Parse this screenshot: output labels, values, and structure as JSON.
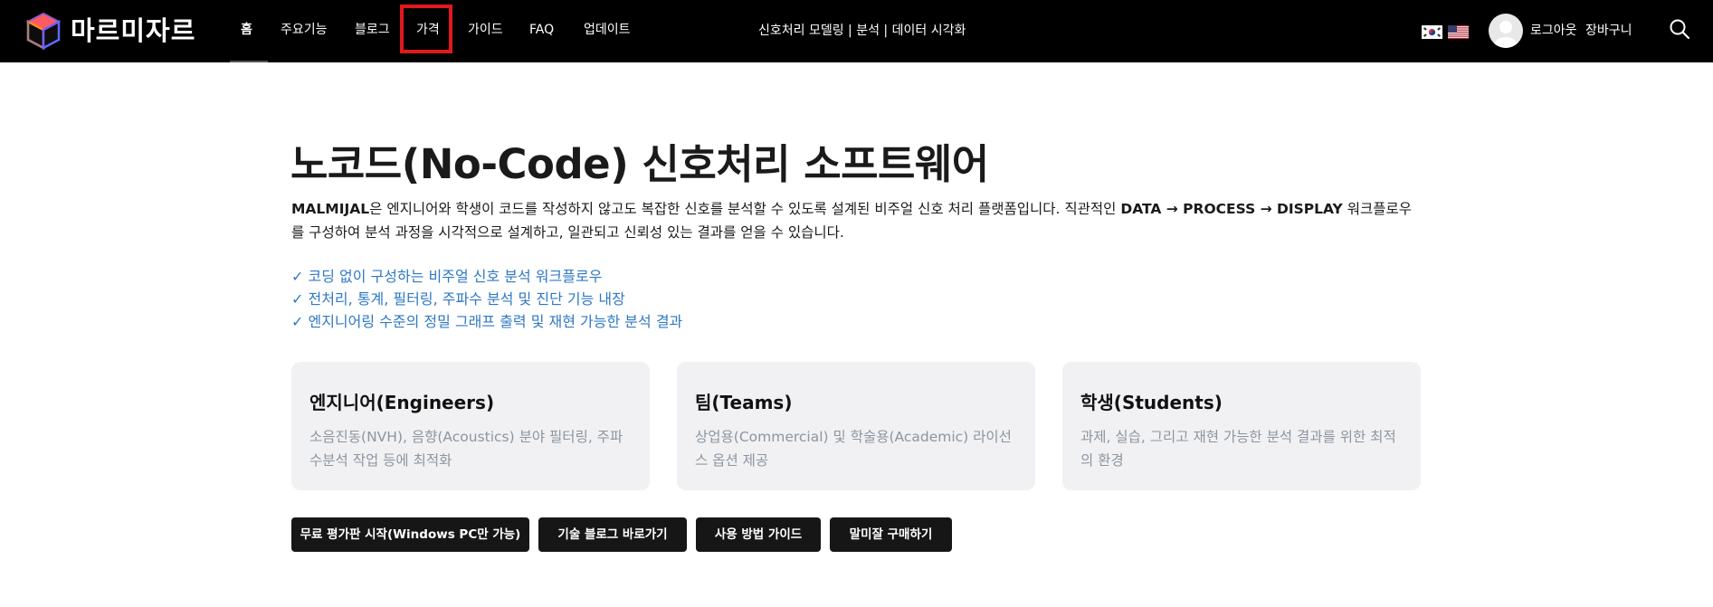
{
  "header": {
    "brand_name": "마르미자르",
    "nav": [
      {
        "label": "홈"
      },
      {
        "label": "주요기능"
      },
      {
        "label": "블로그"
      },
      {
        "label": "가격"
      },
      {
        "label": "가이드"
      },
      {
        "label": "FAQ"
      },
      {
        "label": "업데이트"
      }
    ],
    "active_nav": "홈",
    "highlighted_nav": "가격",
    "tagline": "신호처리 모델링 | 분석 | 데이터 시각화",
    "flags": [
      {
        "icon": "korea-flag-icon"
      },
      {
        "icon": "us-flag-icon"
      }
    ],
    "logout_label": "로그아웃",
    "cart_label": "장바구니",
    "highlight_color": "#e0191e"
  },
  "hero": {
    "title": "노코드(No-Code) 신호처리 소프트웨어",
    "description": {
      "brand": "MALMIJAL",
      "text_1": "은 엔지니어와 학생이 코드를 작성하지 않고도 복잡한 신호를 분석할 수 있도록 설계된 비주얼 신호 처리 플랫폼입니다. 직관적인 ",
      "workflow": "DATA → PROCESS → DISPLAY",
      "text_2": " 워크플로우를 구성하여 분석 과정을 시각적으로 설계하고, 일관되고 신뢰성 있는 결과를 얻을 수 있습니다."
    },
    "features": [
      "✓ 코딩 없이 구성하는 비주얼 신호 분석 워크플로우",
      "✓ 전처리, 통계, 필터링, 주파수 분석 및 진단 기능 내장",
      "✓ 엔지니어링 수준의 정밀 그래프 출력 및 재현 가능한 분석 결과"
    ],
    "feature_color": "#2f78c4"
  },
  "cards": [
    {
      "title": "엔지니어(Engineers)",
      "desc": "소음진동(NVH), 음향(Acoustics) 분야 필터링, 주파수분석 작업 등에 최적화"
    },
    {
      "title": "팀(Teams)",
      "desc": "상업용(Commercial) 및 학술용(Academic) 라이선스 옵션 제공"
    },
    {
      "title": "학생(Students)",
      "desc": "과제, 실습, 그리고 재현 가능한 분석 결과를 위한 최적의 환경"
    }
  ],
  "buttons": [
    {
      "label": "무료 평가판 시작(Windows PC만 가능)"
    },
    {
      "label": "기술 블로그 바로가기"
    },
    {
      "label": "사용 방법 가이드"
    },
    {
      "label": "말미잘 구매하기"
    }
  ]
}
